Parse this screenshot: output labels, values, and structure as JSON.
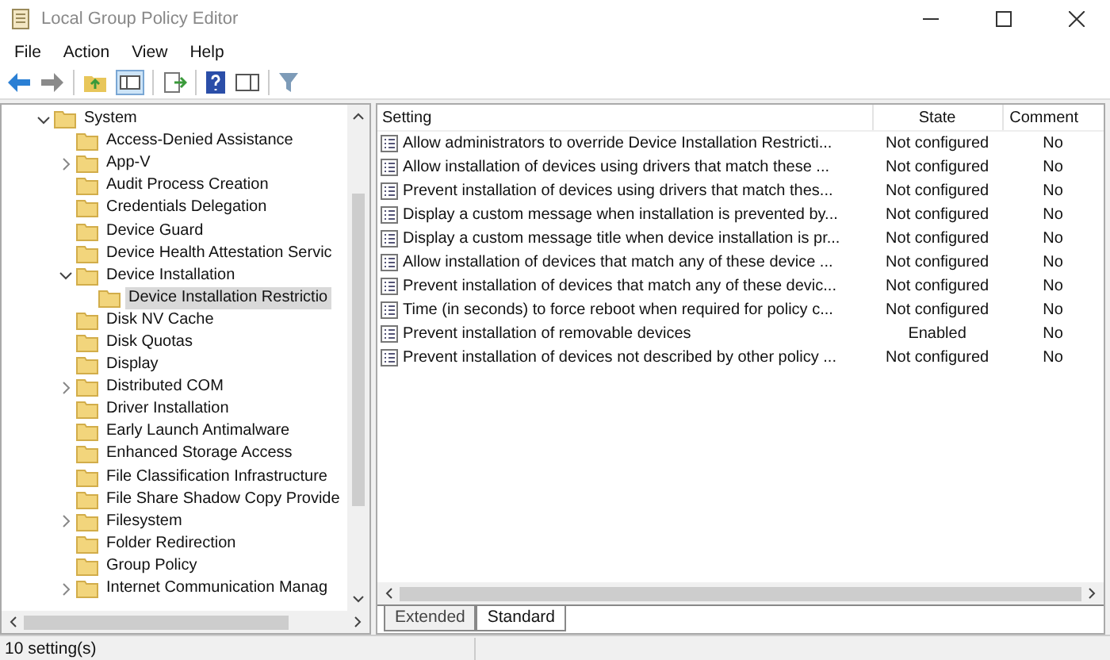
{
  "window": {
    "title": "Local Group Policy Editor"
  },
  "menu": [
    "File",
    "Action",
    "View",
    "Help"
  ],
  "tree": [
    {
      "label": "System",
      "expanded": true,
      "selected": false,
      "children": [
        {
          "label": "Access-Denied Assistance",
          "selected": false
        },
        {
          "label": "App-V",
          "expanded": false,
          "selected": false
        },
        {
          "label": "Audit Process Creation",
          "selected": false
        },
        {
          "label": "Credentials Delegation",
          "selected": false
        },
        {
          "label": "Device Guard",
          "selected": false
        },
        {
          "label": "Device Health Attestation Servic",
          "selected": false
        },
        {
          "label": "Device Installation",
          "expanded": true,
          "selected": false,
          "children": [
            {
              "label": "Device Installation Restrictio",
              "selected": true
            }
          ]
        },
        {
          "label": "Disk NV Cache",
          "selected": false
        },
        {
          "label": "Disk Quotas",
          "selected": false
        },
        {
          "label": "Display",
          "selected": false
        },
        {
          "label": "Distributed COM",
          "expanded": false,
          "selected": false
        },
        {
          "label": "Driver Installation",
          "selected": false
        },
        {
          "label": "Early Launch Antimalware",
          "selected": false
        },
        {
          "label": "Enhanced Storage Access",
          "selected": false
        },
        {
          "label": "File Classification Infrastructure",
          "selected": false
        },
        {
          "label": "File Share Shadow Copy Provide",
          "selected": false
        },
        {
          "label": "Filesystem",
          "expanded": false,
          "selected": false
        },
        {
          "label": "Folder Redirection",
          "selected": false
        },
        {
          "label": "Group Policy",
          "selected": false
        },
        {
          "label": "Internet Communication Manag",
          "expanded": false,
          "selected": false
        }
      ]
    }
  ],
  "table": {
    "columns": [
      "Setting",
      "State",
      "Comment"
    ],
    "rows": [
      {
        "setting": "Allow administrators to override Device Installation Restricti...",
        "state": "Not configured",
        "comment": "No"
      },
      {
        "setting": "Allow installation of devices using drivers that match these ...",
        "state": "Not configured",
        "comment": "No"
      },
      {
        "setting": "Prevent installation of devices using drivers that match thes...",
        "state": "Not configured",
        "comment": "No"
      },
      {
        "setting": "Display a custom message when installation is prevented by...",
        "state": "Not configured",
        "comment": "No"
      },
      {
        "setting": "Display a custom message title when device installation is pr...",
        "state": "Not configured",
        "comment": "No"
      },
      {
        "setting": "Allow installation of devices that match any of these device ...",
        "state": "Not configured",
        "comment": "No"
      },
      {
        "setting": "Prevent installation of devices that match any of these devic...",
        "state": "Not configured",
        "comment": "No"
      },
      {
        "setting": "Time (in seconds) to force reboot when required for policy c...",
        "state": "Not configured",
        "comment": "No"
      },
      {
        "setting": "Prevent installation of removable devices",
        "state": "Enabled",
        "comment": "No"
      },
      {
        "setting": "Prevent installation of devices not described by other policy ...",
        "state": "Not configured",
        "comment": "No"
      }
    ]
  },
  "tabs": [
    {
      "label": "Extended",
      "selected": false
    },
    {
      "label": "Standard",
      "selected": true
    }
  ],
  "status_bar": "10 setting(s)"
}
